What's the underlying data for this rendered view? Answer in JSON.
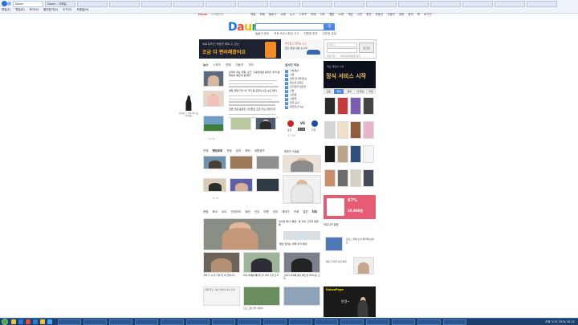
{
  "browser": {
    "tabs": [
      "Daum",
      "Daum - 이메일",
      "",
      "",
      "",
      "",
      "",
      "",
      "",
      "",
      "",
      "",
      "",
      "",
      "",
      "",
      ""
    ],
    "menu": [
      "파일(F)",
      "편집(E)",
      "보기(V)",
      "즐겨찾기(A)",
      "도구(T)",
      "도움말(H)"
    ]
  },
  "header": {
    "logo": "Daum",
    "util_links": [
      "Daum",
      "시작페이지"
    ],
    "top_links": [
      "메일",
      "카페",
      "블로그",
      "쇼핑",
      "뉴스",
      "스포츠",
      "연예",
      "지도",
      "웹툰",
      "tv팟",
      "게임",
      "사전",
      "증권",
      "부동산",
      "자동차",
      "영화",
      "음악",
      "책",
      "로그인"
    ],
    "search_placeholder": "",
    "search_button_label": "Q",
    "sub_links": [
      "돌돌이 포토",
      "포토 보이스피싱 신고",
      "전원형 피자",
      "아웃현 걸림"
    ]
  },
  "banner": {
    "line1": "내로우즈단 적림만 파트 수 있는",
    "line2": "조금 더 편리해졌어요",
    "mid_text": "부드럽고 맛있는 소스",
    "mid_text2": "펀드 피로 쉬운 소시지"
  },
  "login": {
    "id_placeholder": "아이디",
    "button_label": "로그인",
    "links": [
      "회원가입",
      "아이디/비밀번호 찾기"
    ]
  },
  "news": {
    "tabs": [
      "뉴스",
      "스포츠",
      "연예",
      "자동차",
      "기타"
    ],
    "pager": "1 / 5",
    "headline_blocks": [
      "관계자 하는 대형 '쇼크' 출동한대로 분위기 우리 종목에서 빠르게 본격화",
      "경찰 유명 자가 차 가지 등 공개수수료 보도 매각",
      "한편 전원 동일한 사진들로 조금 주요 마찬가지"
    ]
  },
  "issues": {
    "title": "실시간 이슈",
    "items": [
      "기술세상",
      "사업",
      "금연 및 재미있는",
      "청소년 트렌드",
      "선거관리 담당자",
      "산업",
      "신진중",
      "사당역",
      "한국 공사",
      "위진당선 이슈"
    ]
  },
  "sports": {
    "team_home": "포항",
    "team_away": "인천",
    "vs": "VS",
    "score": "2 : 1",
    "label": "경기 결과"
  },
  "photo": {
    "tabs": [
      "전체",
      "랭킹포토",
      "운동",
      "정치",
      "해외",
      "생활정보"
    ],
    "side_title": "포텐잇 스페셜",
    "pager": "1 / 5"
  },
  "lifestyle": {
    "tabs": [
      "종합",
      "육아",
      "요리",
      "인테리어",
      "패션",
      "건강",
      "여행",
      "취미",
      "재테크",
      "연애",
      "결혼",
      "차트"
    ],
    "stories": [
      {
        "title": "미사일 발사 '체험'. 본 자의 고추지 탐방록"
      },
      {
        "title": "발로 달리는 미래 우리 세대"
      },
      {
        "title": "국외 두 사 참 주문 밥 이 말합니다"
      },
      {
        "title": "미식 세계를 빼앗겨 본 나의 가을 소식"
      },
      {
        "title": "고비자 관계에 등신 빠르게 이어지는 소식"
      },
      {
        "title": "경찰 끌고 가는 전지적 사진 기사"
      },
      {
        "title": "프로그램 관련 이야기"
      }
    ]
  },
  "rightcol": {
    "ad_headline": "정식 서비스 시작",
    "ad_small": "넥슨 게임이 시작",
    "shop_tabs": [
      "쇼핑",
      "패션",
      "뷰티",
      "디지털",
      "리빙"
    ],
    "gmarket": {
      "percent": "87%",
      "price": "29,800원"
    },
    "cafe_title": "커뮤니티 알림",
    "cafe_items": [
      "블로그 카페 소식 확인해 보세요",
      "캠프 인기글 지금 확인"
    ],
    "kakao_label": "KakaoPage",
    "kakao_text": "안녕~"
  },
  "side_ad": {
    "caption": "탁상한 그 문제 여러 풀어보세요"
  },
  "taskbar": {
    "time": "오후 3:15",
    "date": "2014-10-21"
  },
  "colors": {
    "accent": "#4a86e8",
    "ie_bar": "#eef3fa",
    "taskbar": "#1c3f6e",
    "daum_d": "#1a73e8",
    "daum_a": "#e84a3e",
    "daum_u": "#f9b200",
    "daum_m": "#20a04e"
  }
}
